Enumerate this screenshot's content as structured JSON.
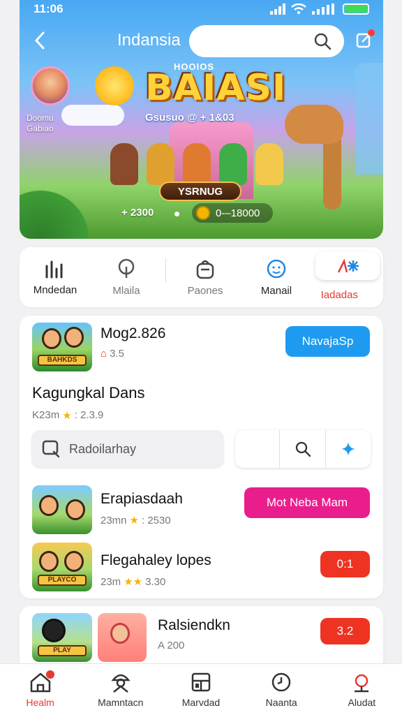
{
  "status": {
    "time": "11:06"
  },
  "header": {
    "title": "Indansia"
  },
  "hero": {
    "avatar_name": "Doomu Gabiao",
    "logo_top": "HOOIOS",
    "logo": "BAIASI",
    "subtitle": "Gsusuo @ + 1&03",
    "banner": "YSRNUG",
    "stat_plus": "+ 2300",
    "stat_coin": "0-–18000"
  },
  "categories": [
    {
      "label": "Mndedan",
      "icon": "chart-bars-icon"
    },
    {
      "label": "Mlaila",
      "icon": "pin-icon"
    },
    {
      "label": "Paones",
      "icon": "bag-icon"
    },
    {
      "label": "Manail",
      "icon": "smiley-icon"
    },
    {
      "label": "Iadadas",
      "icon": "sparkle-icon"
    }
  ],
  "list": {
    "item1": {
      "title": "Mog2.826",
      "meta": "3.5",
      "thumb_label": "BAHKDS",
      "button": "NavajaSp"
    },
    "section": {
      "title": "Kagungkal Dans",
      "meta_prefix": "K23m",
      "meta_rating": ": 2.3.9"
    },
    "search_placeholder": "Radoilarhay",
    "item2": {
      "title": "Erapiasdaah",
      "meta_prefix": "23mn",
      "meta_rating": ": 2530",
      "button": "Mot Neba Mam"
    },
    "item3": {
      "title": "Flegahaley lopes",
      "meta_prefix": "23m",
      "meta_rating": "3.30",
      "thumb_label": "PLAYCO",
      "button": "0:1"
    }
  },
  "card2": {
    "title": "Ralsiendkn",
    "meta": "A 200",
    "thumb_label": "PLAY",
    "button": "3.2"
  },
  "nav": [
    {
      "label": "Healm",
      "icon": "home-icon"
    },
    {
      "label": "Mamntacn",
      "icon": "user-icon"
    },
    {
      "label": "Marvdad",
      "icon": "grid-icon"
    },
    {
      "label": "Naanta",
      "icon": "clock-icon"
    },
    {
      "label": "Aludat",
      "icon": "alert-icon"
    }
  ],
  "colors": {
    "accent": "#e53935",
    "blue": "#1e9bf0",
    "pink": "#e91e8c",
    "red": "#ee3323"
  }
}
